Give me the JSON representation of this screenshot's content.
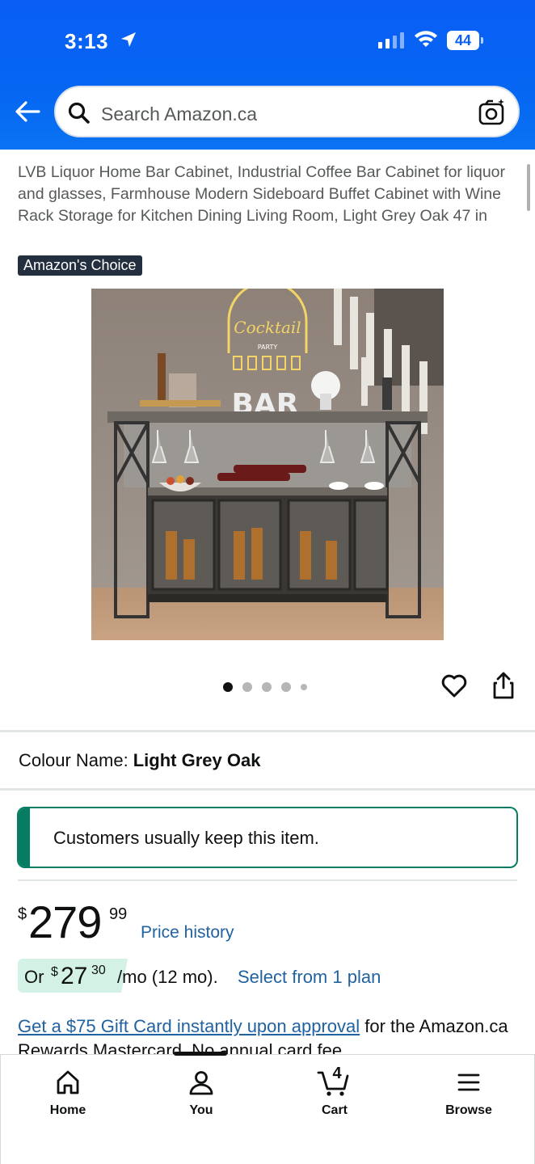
{
  "status_bar": {
    "time": "3:13",
    "battery": "44"
  },
  "search": {
    "placeholder": "Search Amazon.ca"
  },
  "product": {
    "title": "LVB Liquor Home Bar Cabinet, Industrial Coffee Bar Cabinet for liquor and glasses, Farmhouse Modern Sideboard Buffet Cabinet with Wine Rack Storage for Kitchen Dining Living Room, Light Grey Oak 47 in",
    "badge": "Amazon's Choice",
    "image_text": {
      "sign": "Cocktail",
      "sign_sub": "PARTY",
      "letters": "BAR"
    },
    "image_count": 5,
    "active_image": 1
  },
  "colour": {
    "label": "Colour Name:",
    "value": "Light Grey Oak"
  },
  "keep_message": "Customers usually keep this item.",
  "price": {
    "symbol": "$",
    "whole": "279",
    "fraction": "99",
    "history_link": "Price history"
  },
  "monthly": {
    "prefix": "Or",
    "symbol": "$",
    "whole": "27",
    "fraction": "30",
    "suffix": "/mo (12 mo).",
    "link": "Select from 1 plan"
  },
  "gift_card": {
    "link": "Get a $75 Gift Card instantly upon approval",
    "text": "for the Amazon.ca Rewards Mastercard. No annual card fee."
  },
  "bottom_nav": {
    "items": [
      {
        "label": "Home",
        "icon": "home-icon"
      },
      {
        "label": "You",
        "icon": "person-icon"
      },
      {
        "label": "Cart",
        "icon": "cart-icon",
        "count": "4"
      },
      {
        "label": "Browse",
        "icon": "menu-icon"
      }
    ]
  },
  "colors": {
    "header": "#0a5ef6",
    "link": "#2162a1",
    "keep_accent": "#067d62",
    "badge": "#232f3e"
  }
}
